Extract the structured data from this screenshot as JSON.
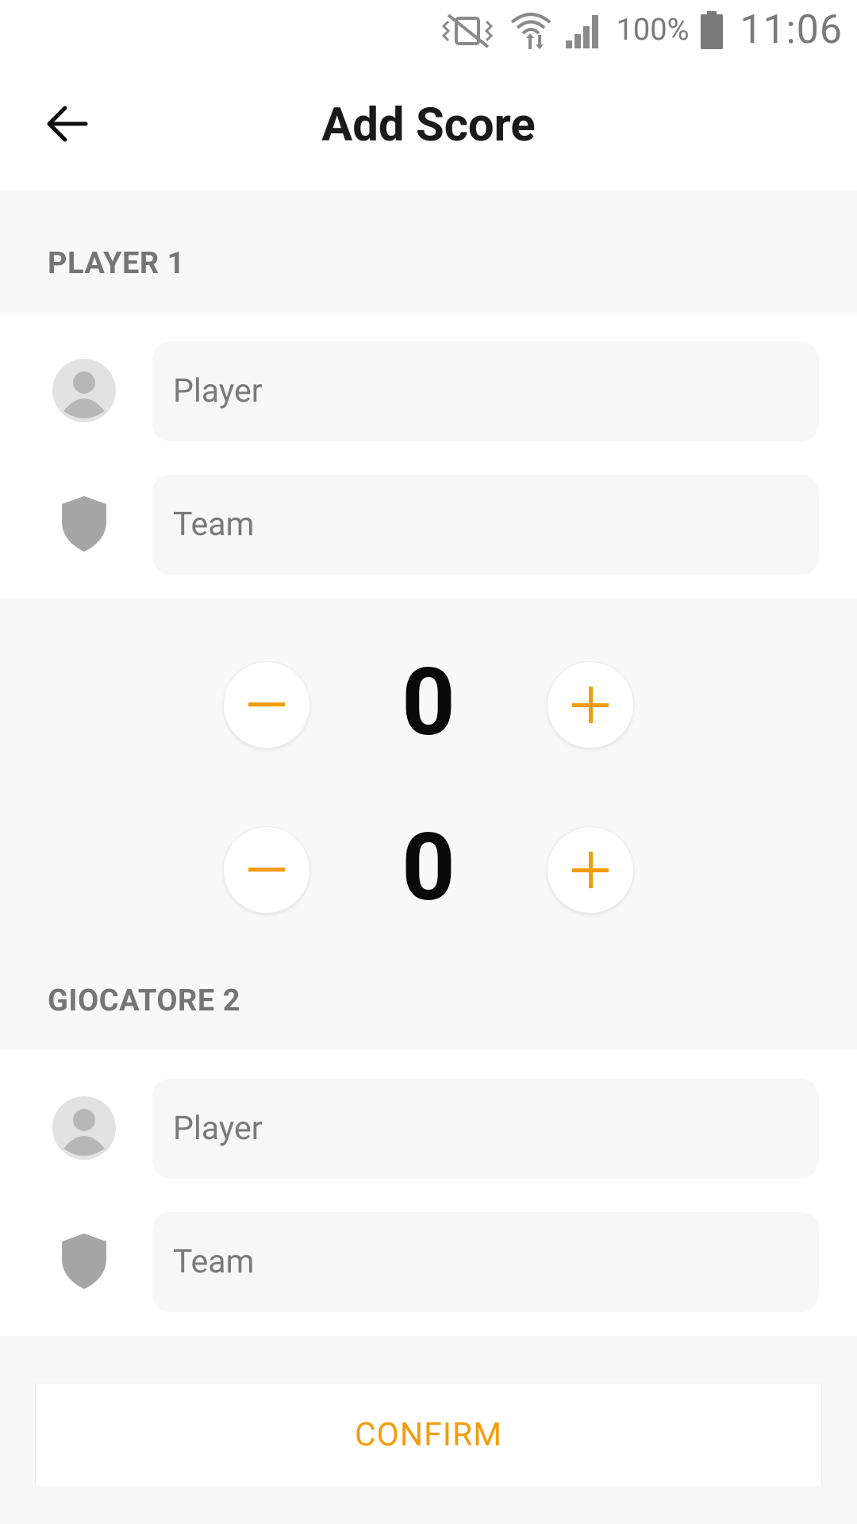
{
  "status_bar": {
    "battery_percent": "100%",
    "time": "11:06",
    "icons": [
      "vibrate-off-icon",
      "wifi-icon",
      "cellular-signal-icon",
      "battery-icon"
    ]
  },
  "app_bar": {
    "title": "Add Score",
    "back_icon": "arrow-left-icon"
  },
  "player1": {
    "header": "PLAYER 1",
    "player_placeholder": "Player",
    "team_placeholder": "Team",
    "player_value": "",
    "team_value": ""
  },
  "scores": [
    {
      "value": "0",
      "decrement_icon": "minus-icon",
      "increment_icon": "plus-icon"
    },
    {
      "value": "0",
      "decrement_icon": "minus-icon",
      "increment_icon": "plus-icon"
    }
  ],
  "player2": {
    "header": "GIOCATORE 2",
    "player_placeholder": "Player",
    "team_placeholder": "Team",
    "player_value": "",
    "team_value": ""
  },
  "confirm_label": "CONFIRM",
  "colors": {
    "accent": "#f59c0b",
    "background": "#f8f8f8",
    "surface": "#ffffff",
    "icon_gray": "#a6a6a6",
    "header_text": "#757575"
  }
}
